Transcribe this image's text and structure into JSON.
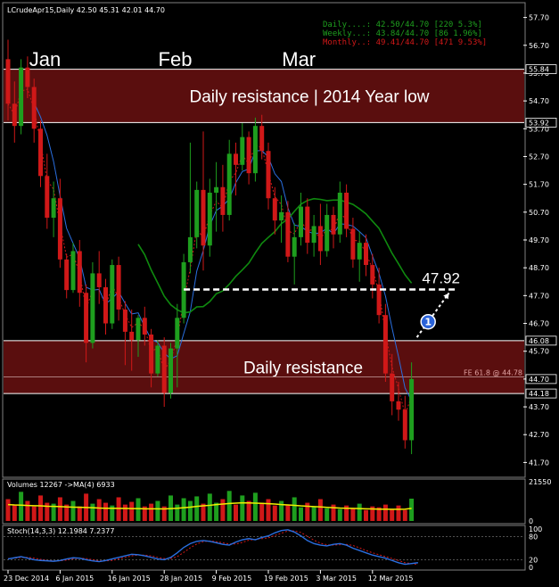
{
  "colors": {
    "background": "#000000",
    "bull": "#1e9e1e",
    "bear": "#d01818",
    "zone": "#5a0e0e",
    "ema_blue": "#2a6fe0",
    "sma_green": "#0f8a0f",
    "ma_red_dotted": "#d01818",
    "volume_ma": "#f0f000",
    "stoch_main": "#2a6fe0",
    "stoch_signal": "#d01818",
    "info_daily": "#1e9e1e",
    "info_weekly": "#1e9e1e",
    "info_monthly": "#d01818"
  },
  "chart_data": {
    "type": "candlestick",
    "title": "LCrudeApr15,Daily  42.50 45.31 42.01 44.70",
    "symbol_info": [
      "Daily....: 42.50/44.70 [220 5.3%]",
      "Weekly...: 43.84/44.70 [86 1.96%]",
      "Monthly..: 49.41/44.70 [471 9.53%]"
    ],
    "month_labels": [
      {
        "text": "Jan",
        "index": 5
      },
      {
        "text": "Feb",
        "index": 25
      },
      {
        "text": "Mar",
        "index": 44
      }
    ],
    "price_axis": {
      "ylim": [
        41.2,
        58.2
      ],
      "ticks": [
        "57.70",
        "56.70",
        "55.70",
        "54.70",
        "53.70",
        "52.70",
        "51.70",
        "50.70",
        "49.70",
        "48.70",
        "47.70",
        "46.70",
        "45.70",
        "44.70",
        "43.70",
        "42.70",
        "41.70"
      ],
      "highlight_labels": [
        "55.84",
        "53.92",
        "46.08",
        "44.70",
        "44.18"
      ]
    },
    "x_axis": {
      "labels": [
        {
          "text": "23 Dec 2014",
          "index": 0
        },
        {
          "text": "6 Jan 2015",
          "index": 8
        },
        {
          "text": "16 Jan 2015",
          "index": 16
        },
        {
          "text": "28 Jan 2015",
          "index": 24
        },
        {
          "text": "9 Feb 2015",
          "index": 32
        },
        {
          "text": "19 Feb 2015",
          "index": 40
        },
        {
          "text": "3 Mar 2015",
          "index": 48
        },
        {
          "text": "12 Mar 2015",
          "index": 56
        }
      ]
    },
    "zones": [
      {
        "label": "Daily resistance | 2014 Year low",
        "low": 53.92,
        "high": 55.84
      },
      {
        "label": "Daily resistance",
        "low": 44.18,
        "high": 46.08
      }
    ],
    "fib_line": {
      "label": "FE 61.8 @ 44.78",
      "value": 44.78
    },
    "target": {
      "label": "47.92",
      "value": 47.92,
      "start_index": 27,
      "end_index": 69
    },
    "marker": {
      "label": "1"
    },
    "candles": [
      [
        56.2,
        56.9,
        54.0,
        54.6
      ],
      [
        54.6,
        55.4,
        53.2,
        53.8
      ],
      [
        53.8,
        56.2,
        53.5,
        55.9
      ],
      [
        55.9,
        56.3,
        54.8,
        55.2
      ],
      [
        55.2,
        55.5,
        53.2,
        53.7
      ],
      [
        53.7,
        54.0,
        51.6,
        52.0
      ],
      [
        52.0,
        52.8,
        50.1,
        50.5
      ],
      [
        50.5,
        51.8,
        49.8,
        51.2
      ],
      [
        51.2,
        51.9,
        48.7,
        49.0
      ],
      [
        49.0,
        49.2,
        47.6,
        47.9
      ],
      [
        47.9,
        49.6,
        47.8,
        49.3
      ],
      [
        49.3,
        49.7,
        47.3,
        47.8
      ],
      [
        47.8,
        48.1,
        45.3,
        46.0
      ],
      [
        46.0,
        48.9,
        45.8,
        48.5
      ],
      [
        48.5,
        49.3,
        47.4,
        48.0
      ],
      [
        48.0,
        48.3,
        46.3,
        46.7
      ],
      [
        46.7,
        49.0,
        46.5,
        48.8
      ],
      [
        48.8,
        49.1,
        46.8,
        47.2
      ],
      [
        47.2,
        47.5,
        45.2,
        46.4
      ],
      [
        46.4,
        47.2,
        45.0,
        46.1
      ],
      [
        46.1,
        47.0,
        45.5,
        46.9
      ],
      [
        46.9,
        47.3,
        45.9,
        46.3
      ],
      [
        46.3,
        46.5,
        44.4,
        44.9
      ],
      [
        44.9,
        46.1,
        44.8,
        45.9
      ],
      [
        45.9,
        46.2,
        43.7,
        44.2
      ],
      [
        44.2,
        46.0,
        44.0,
        45.8
      ],
      [
        45.8,
        47.4,
        44.4,
        46.9
      ],
      [
        46.9,
        49.2,
        46.7,
        48.9
      ],
      [
        48.9,
        53.2,
        48.5,
        49.8
      ],
      [
        49.8,
        51.8,
        49.4,
        51.5
      ],
      [
        51.5,
        53.6,
        48.6,
        49.5
      ],
      [
        49.5,
        51.9,
        49.1,
        51.4
      ],
      [
        51.4,
        52.5,
        50.0,
        51.6
      ],
      [
        51.6,
        52.4,
        50.0,
        50.6
      ],
      [
        50.6,
        53.3,
        50.4,
        52.8
      ],
      [
        52.8,
        53.2,
        51.3,
        52.4
      ],
      [
        52.4,
        53.9,
        52.2,
        53.4
      ],
      [
        53.4,
        53.6,
        51.7,
        52.1
      ],
      [
        52.1,
        54.1,
        51.8,
        53.8
      ],
      [
        53.8,
        54.2,
        52.6,
        52.9
      ],
      [
        52.9,
        53.2,
        50.8,
        51.2
      ],
      [
        51.2,
        51.6,
        49.9,
        50.4
      ],
      [
        50.4,
        51.3,
        49.6,
        50.7
      ],
      [
        50.7,
        51.1,
        48.9,
        49.1
      ],
      [
        49.1,
        50.3,
        48.1,
        49.8
      ],
      [
        49.8,
        51.4,
        49.5,
        50.9
      ],
      [
        50.9,
        51.2,
        49.2,
        49.6
      ],
      [
        49.6,
        50.6,
        49.1,
        50.2
      ],
      [
        50.2,
        51.0,
        48.8,
        49.3
      ],
      [
        49.3,
        51.0,
        49.1,
        50.6
      ],
      [
        50.6,
        50.9,
        49.4,
        49.9
      ],
      [
        49.9,
        51.8,
        49.6,
        51.4
      ],
      [
        51.4,
        51.7,
        49.8,
        50.1
      ],
      [
        50.1,
        50.5,
        48.7,
        49.0
      ],
      [
        49.0,
        50.0,
        48.2,
        49.6
      ],
      [
        49.6,
        49.9,
        48.4,
        48.8
      ],
      [
        48.8,
        49.2,
        47.6,
        48.1
      ],
      [
        48.1,
        48.7,
        46.7,
        47.0
      ],
      [
        47.0,
        47.4,
        44.6,
        44.9
      ],
      [
        44.9,
        45.6,
        43.4,
        43.9
      ],
      [
        43.9,
        44.6,
        43.2,
        43.6
      ],
      [
        43.6,
        44.1,
        42.2,
        42.5
      ],
      [
        42.5,
        45.3,
        42.0,
        44.7
      ]
    ],
    "volume": {
      "label": "Volumes 12267 ->MA(4) 6933",
      "ticks": [
        "21550",
        "0"
      ],
      "ylim": [
        0,
        21550
      ],
      "values": [
        12000,
        9000,
        16000,
        11000,
        8000,
        14000,
        10000,
        9500,
        13000,
        9000,
        11000,
        8000,
        15000,
        9500,
        12000,
        10000,
        8500,
        13000,
        9000,
        10500,
        12500,
        8000,
        9500,
        11000,
        8000,
        14000,
        9000,
        12500,
        11000,
        13500,
        9500,
        15000,
        10000,
        12000,
        16500,
        9000,
        14000,
        11000,
        15500,
        10000,
        12000,
        8500,
        11000,
        9000,
        13000,
        7500,
        10000,
        8000,
        12000,
        7000,
        9000,
        6500,
        8500,
        7000,
        9500,
        6000,
        8000,
        7500,
        9000,
        6500,
        8500,
        6000,
        12267
      ],
      "ma": [
        9000,
        8800,
        8700,
        8500,
        8400,
        8300,
        8100,
        8000,
        7900,
        7700,
        7600,
        7500,
        7400,
        7300,
        7100,
        7000,
        7000,
        6900,
        6900,
        6800,
        6800,
        6700,
        6700,
        6700,
        6600,
        6800,
        7000,
        7300,
        7600,
        8000,
        8300,
        8600,
        9000,
        9300,
        9600,
        9800,
        10000,
        9900,
        9800,
        9700,
        9500,
        9300,
        9000,
        8800,
        8600,
        8300,
        8100,
        7900,
        7700,
        7500,
        7300,
        7100,
        7000,
        6900,
        6800,
        6700,
        6600,
        6500,
        6500,
        6400,
        6400,
        6500,
        6933
      ]
    },
    "stochastic": {
      "label": "Stoch(14,3,3) 12.1984 7.2377",
      "ticks": [
        "100",
        "80",
        "20",
        "0"
      ],
      "ylim": [
        0,
        100
      ],
      "main": [
        22,
        25,
        28,
        24,
        20,
        18,
        17,
        16,
        18,
        22,
        25,
        24,
        20,
        17,
        15,
        18,
        22,
        26,
        30,
        34,
        33,
        30,
        26,
        22,
        20,
        26,
        38,
        52,
        62,
        68,
        70,
        68,
        64,
        60,
        58,
        66,
        72,
        75,
        72,
        78,
        82,
        90,
        96,
        98,
        92,
        82,
        70,
        62,
        58,
        56,
        60,
        62,
        58,
        50,
        44,
        38,
        32,
        28,
        24,
        18,
        12,
        8,
        10,
        12.2
      ],
      "signal": [
        23,
        24,
        26,
        26,
        24,
        21,
        18,
        17,
        17,
        19,
        22,
        24,
        23,
        20,
        17,
        17,
        18,
        22,
        26,
        30,
        32,
        32,
        30,
        26,
        23,
        23,
        28,
        39,
        51,
        61,
        67,
        69,
        67,
        64,
        61,
        61,
        65,
        71,
        73,
        75,
        77,
        83,
        89,
        95,
        95,
        91,
        81,
        71,
        63,
        59,
        58,
        59,
        60,
        57,
        51,
        44,
        38,
        33,
        28,
        23,
        18,
        12,
        10,
        7.2
      ]
    }
  }
}
